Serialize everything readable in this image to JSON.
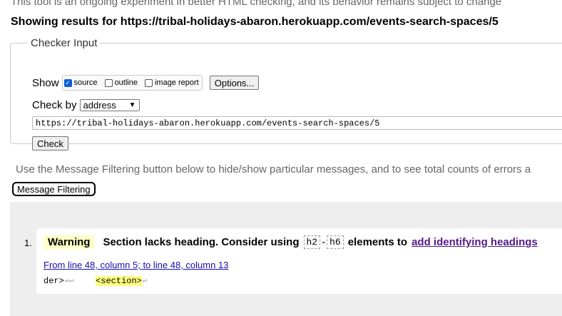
{
  "top_note": "This tool is an ongoing experiment in better HTML checking, and its behavior remains subject to change",
  "results_heading": "Showing results for https://tribal-holidays-abaron.herokuapp.com/events-search-spaces/5",
  "checker": {
    "legend": "Checker Input",
    "show_label": "Show",
    "options": [
      {
        "label": "source",
        "checked": true
      },
      {
        "label": "outline",
        "checked": false
      },
      {
        "label": "image report",
        "checked": false
      }
    ],
    "options_button": "Options...",
    "check_by_label": "Check by",
    "check_by_value": "address",
    "url_value": "https://tribal-holidays-abaron.herokuapp.com/events-search-spaces/5",
    "check_button": "Check"
  },
  "filter_note": "Use the Message Filtering button below to hide/show particular messages, and to see total counts of errors a",
  "filter_button": "Message Filtering",
  "messages": [
    {
      "number": "1.",
      "type": "Warning",
      "text_before": "Section lacks heading. Consider using",
      "code1": "h2",
      "dash": "-",
      "code2": "h6",
      "text_after": "elements to",
      "link": "add identifying headings",
      "location": "From line 48, column 5; to line 48, column 13",
      "extract_prefix": "der>",
      "extract_returns": "↩↩",
      "extract_highlight": "<section>",
      "extract_suffix": "↩"
    }
  ],
  "colors": {
    "warning_badge": "#ffffc6",
    "highlight": "#ffff80",
    "link": "#551a8b",
    "location_link": "#1a0dab",
    "panel_bg": "#eeeeee"
  }
}
